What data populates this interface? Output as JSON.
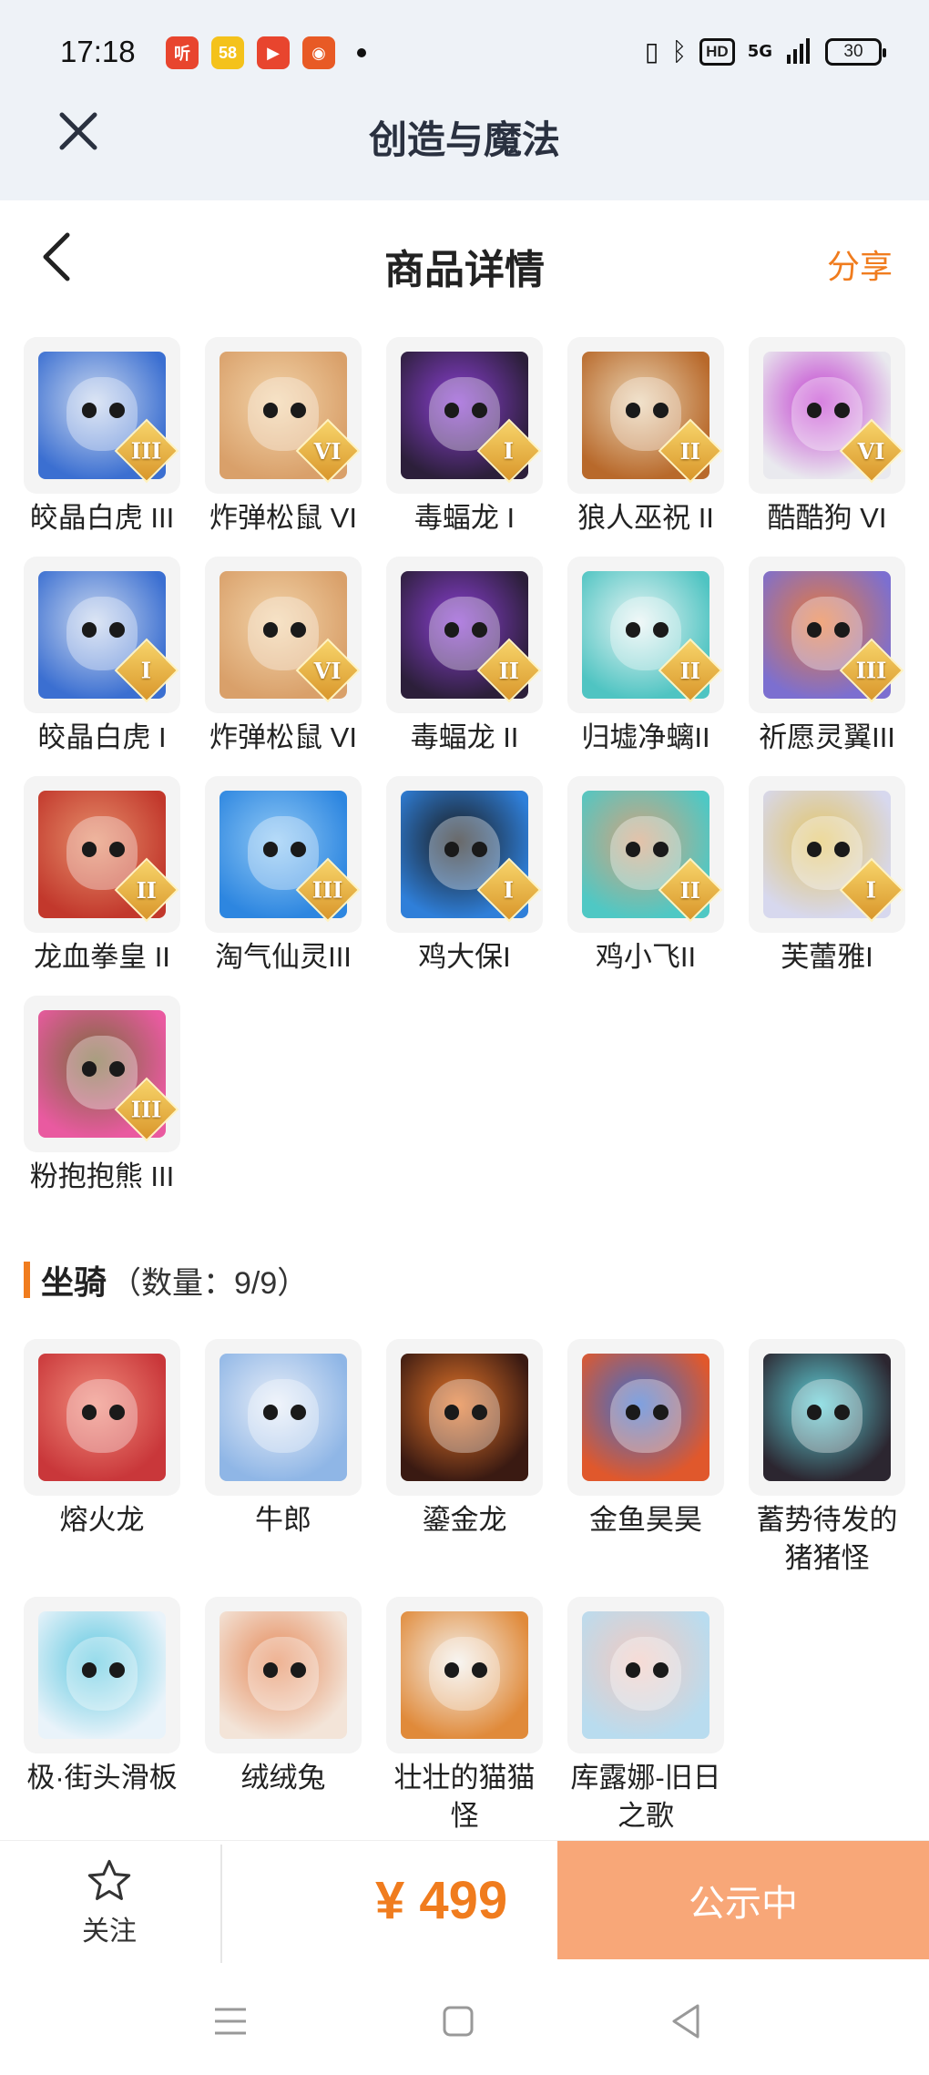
{
  "status_bar": {
    "time": "17:18",
    "apps": [
      {
        "name": "ting-app",
        "glyph": "听",
        "color": "#e8452e"
      },
      {
        "name": "58-app",
        "glyph": "58",
        "color": "#f4c21b"
      },
      {
        "name": "video-app",
        "glyph": "▶",
        "color": "#e8452e"
      },
      {
        "name": "pumpkin-app",
        "glyph": "◉",
        "color": "#e85a25"
      }
    ],
    "hd": "HD",
    "signal": "5G",
    "battery": "30"
  },
  "app_bar": {
    "title": "创造与魔法"
  },
  "header": {
    "title": "商品详情",
    "share": "分享"
  },
  "pets": [
    {
      "label": "皎晶白虎 III",
      "rank": "III",
      "c1": "#3b6fd1",
      "c2": "#c9d7ef"
    },
    {
      "label": "炸弹松鼠 VI",
      "rank": "VI",
      "c1": "#d9a06a",
      "c2": "#f2d3a8"
    },
    {
      "label": "毒蝠龙 I",
      "rank": "I",
      "c1": "#2c1f3a",
      "c2": "#8a3fd2"
    },
    {
      "label": "狼人巫祝 II",
      "rank": "II",
      "c1": "#b8692b",
      "c2": "#e9d2b0"
    },
    {
      "label": "酷酷狗 VI",
      "rank": "VI",
      "c1": "#e9e9ee",
      "c2": "#c23fd0"
    },
    {
      "label": "皎晶白虎 I",
      "rank": "I",
      "c1": "#3b6fd1",
      "c2": "#c9d7ef"
    },
    {
      "label": "炸弹松鼠 VI",
      "rank": "VI",
      "c1": "#d9a06a",
      "c2": "#f2d3a8"
    },
    {
      "label": "毒蝠龙 II",
      "rank": "II",
      "c1": "#2c1f3a",
      "c2": "#8a3fd2"
    },
    {
      "label": "归墟净螭II",
      "rank": "II",
      "c1": "#4fc4c2",
      "c2": "#e8f4f4"
    },
    {
      "label": "祈愿灵翼III",
      "rank": "III",
      "c1": "#7c6fd0",
      "c2": "#e97a3a"
    },
    {
      "label": "龙血拳皇 II",
      "rank": "II",
      "c1": "#c2382c",
      "c2": "#e58e6a"
    },
    {
      "label": "淘气仙灵III",
      "rank": "III",
      "c1": "#2d86e0",
      "c2": "#8fc8f5"
    },
    {
      "label": "鸡大保I",
      "rank": "I",
      "c1": "#2f7fd9",
      "c2": "#1a1a1a"
    },
    {
      "label": "鸡小飞II",
      "rank": "II",
      "c1": "#4fc8c4",
      "c2": "#d4a27c"
    },
    {
      "label": "芙蕾雅I",
      "rank": "I",
      "c1": "#d7d8ee",
      "c2": "#e3c565"
    },
    {
      "label": "粉抱抱熊 III",
      "rank": "III",
      "c1": "#e95aa0",
      "c2": "#7a6a3a"
    }
  ],
  "mounts_section": {
    "title": "坐骑",
    "count": "（数量：9/9）"
  },
  "mounts": [
    {
      "label": "熔火龙",
      "c1": "#c9373a",
      "c2": "#f08a7a"
    },
    {
      "label": "牛郎",
      "c1": "#8fb6e6",
      "c2": "#e8eef8"
    },
    {
      "label": "鎏金龙",
      "c1": "#3a1a12",
      "c2": "#e5762a"
    },
    {
      "label": "金鱼昊昊",
      "c1": "#e0582c",
      "c2": "#3a6fd0"
    },
    {
      "label": "蓄势待发的猪猪怪",
      "c1": "#2c2630",
      "c2": "#5fd0d8"
    },
    {
      "label": "极·街头滑板",
      "c1": "#e9f3fa",
      "c2": "#5fc8e0"
    },
    {
      "label": "绒绒兔",
      "c1": "#f3e4d8",
      "c2": "#e58a5a"
    },
    {
      "label": "壮壮的猫猫怪",
      "c1": "#e08a3a",
      "c2": "#f4f0ea"
    },
    {
      "label": "库露娜-旧日之歌",
      "c1": "#b9dcef",
      "c2": "#f2c9c0"
    }
  ],
  "action_bar": {
    "follow": "关注",
    "price": "¥ 499",
    "status": "公示中"
  },
  "colors": {
    "accent": "#f07c1e",
    "button": "#f8a778",
    "top_bg": "#eef2f7"
  }
}
